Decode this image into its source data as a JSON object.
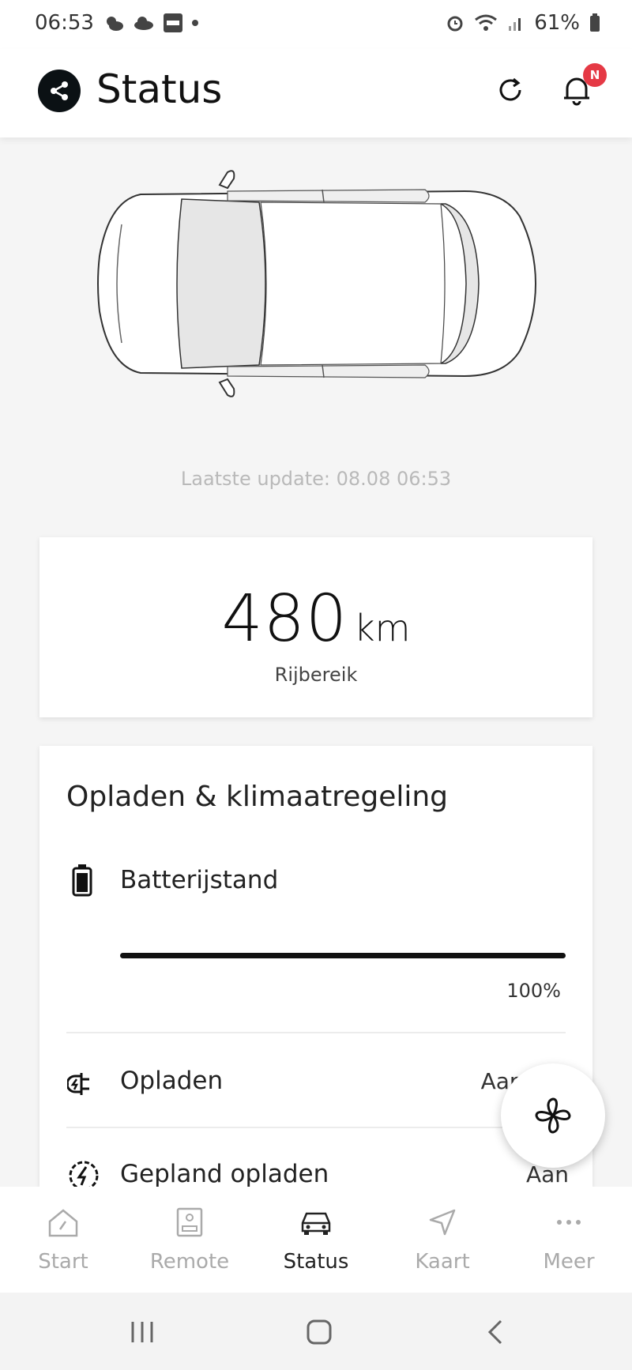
{
  "status_bar": {
    "time": "06:53",
    "battery_percent": "61%",
    "left_icons": [
      "weather-icon",
      "cloud-icon",
      "kia-app-icon",
      "dot-icon"
    ],
    "right_icons": [
      "alarm-icon",
      "wifi-icon",
      "signal-icon",
      "battery-icon"
    ]
  },
  "header": {
    "title": "Status",
    "notification_badge": "N",
    "badge_color": "#e53945"
  },
  "vehicle": {
    "last_update": "Laatste update: 08.08 06:53"
  },
  "range": {
    "value": "480",
    "unit": "km",
    "label": "Rijbereik"
  },
  "charging": {
    "title": "Opladen & klimaatregeling",
    "battery": {
      "label": "Batterijstand",
      "percent_text": "100%",
      "percent": 100
    },
    "rows": [
      {
        "label": "Opladen",
        "value": "Aangesl",
        "icon": "charging-plug-icon"
      },
      {
        "label": "Gepland opladen",
        "value": "Aan",
        "icon": "scheduled-charge-icon"
      }
    ]
  },
  "bottom_nav": {
    "items": [
      {
        "label": "Start",
        "icon": "home-icon",
        "active": false
      },
      {
        "label": "Remote",
        "icon": "remote-icon",
        "active": false
      },
      {
        "label": "Status",
        "icon": "car-icon",
        "active": true
      },
      {
        "label": "Kaart",
        "icon": "navigation-icon",
        "active": false
      },
      {
        "label": "Meer",
        "icon": "more-icon",
        "active": false
      }
    ]
  }
}
